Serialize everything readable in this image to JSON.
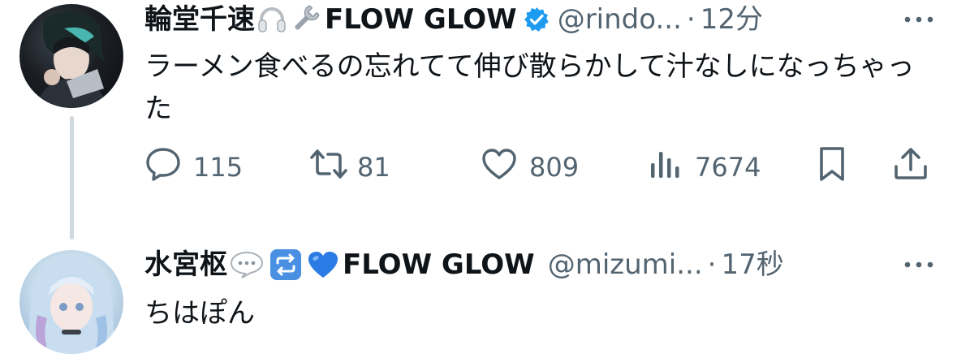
{
  "tweets": [
    {
      "display_name": "輪堂千速",
      "emojis": [
        "headphones-emoji",
        "wrench-emoji"
      ],
      "group": "FLOW GLOW",
      "verified": true,
      "handle": "@rindo...",
      "separator": "·",
      "time": "12分",
      "text": "ラーメン食べるの忘れてて伸び散らかして汁なしになっちゃった",
      "actions": {
        "replies": "115",
        "reposts": "81",
        "likes": "809",
        "views": "7674"
      }
    },
    {
      "display_name": "水宮枢",
      "emojis": [
        "speech-balloon-emoji",
        "repeat-emoji",
        "blue-heart-emoji"
      ],
      "group": "FLOW GLOW",
      "verified": false,
      "handle": "@mizumi...",
      "separator": "·",
      "time": "17秒",
      "text": "ちはぽん"
    }
  ],
  "colors": {
    "text_primary": "#0f1419",
    "text_secondary": "#536471",
    "verified_blue": "#1d9bf0",
    "thread_line": "#cfd9de"
  }
}
